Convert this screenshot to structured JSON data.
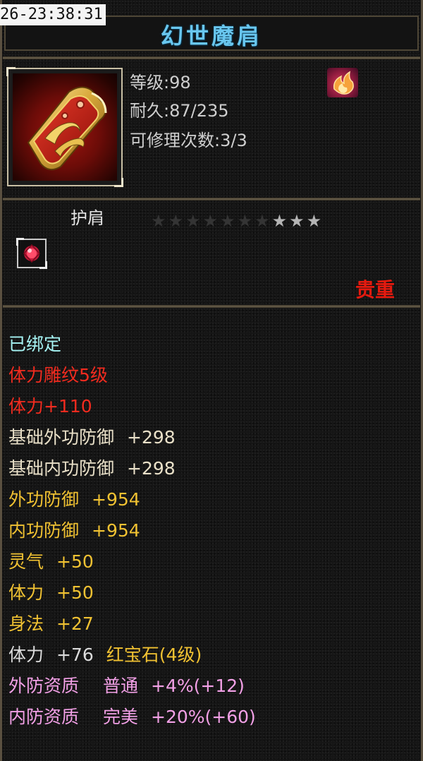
{
  "timestamp": "26-23:38:31",
  "item": {
    "name": "幻世魔肩",
    "level": "等级:98",
    "durability": "耐久:87/235",
    "repairs": "可修理次数:3/3",
    "slot_type": "护肩",
    "stars": {
      "total": 10,
      "lit": 3
    },
    "rarity": "贵重",
    "icon": "shoulder-armor-icon",
    "element_icon": "fire-element-icon",
    "gem_icon": "ruby-gem-icon"
  },
  "attributes": {
    "bound": "已绑定",
    "engraving": "体力雕纹5级",
    "engraving_stat": "体力+110",
    "base_outer_def": {
      "label": "基础外功防御",
      "value": "+298"
    },
    "base_inner_def": {
      "label": "基础内功防御",
      "value": "+298"
    },
    "outer_def": {
      "label": "外功防御",
      "value": "+954"
    },
    "inner_def": {
      "label": "内功防御",
      "value": "+954"
    },
    "spirit": {
      "label": "灵气",
      "value": "+50"
    },
    "stamina": {
      "label": "体力",
      "value": "+50"
    },
    "agility": {
      "label": "身法",
      "value": "+27"
    },
    "gem": {
      "label": "体力",
      "value": "+76",
      "gem_name": "红宝石(4级)"
    },
    "outer_quality": {
      "label": "外防资质",
      "grade": "普通",
      "bonus": "+4%(+12)"
    },
    "inner_quality": {
      "label": "内防资质",
      "grade": "完美",
      "bonus": "+20%(+60)"
    }
  },
  "colors": {
    "title": "#69c7ef",
    "rarity": "#e51a0f",
    "bound": "#a6f4f4",
    "engraving": "#f22b1f",
    "base_stat": "#e9e0c8",
    "bonus_stat": "#f1c232",
    "quality": "#f2a0e6"
  }
}
